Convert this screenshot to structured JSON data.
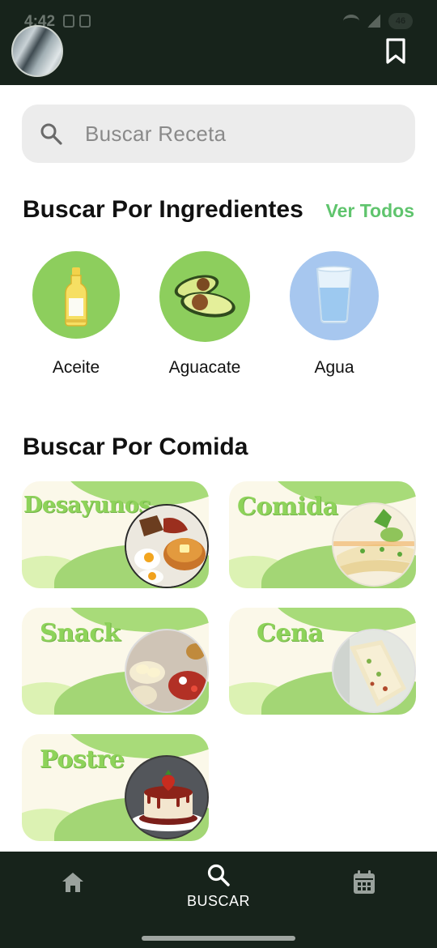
{
  "status_bar": {
    "time": "4:42",
    "battery": "46"
  },
  "search": {
    "placeholder": "Buscar Receta"
  },
  "ingredients_section": {
    "title": "Buscar Por Ingredientes",
    "see_all": "Ver Todos",
    "items": [
      {
        "label": "Aceite",
        "icon": "oil-bottle-icon",
        "bg": "#8dce5d"
      },
      {
        "label": "Aguacate",
        "icon": "avocado-icon",
        "bg": "#8dce5d"
      },
      {
        "label": "Agua",
        "icon": "water-glass-icon",
        "bg": "#a7c7ef"
      }
    ]
  },
  "meals_section": {
    "title": "Buscar Por Comida",
    "items": [
      {
        "label": "Desayunos",
        "icon": "breakfast-plate-icon"
      },
      {
        "label": "Comida",
        "icon": "enchiladas-plate-icon"
      },
      {
        "label": "Snack",
        "icon": "snack-plate-icon"
      },
      {
        "label": "Cena",
        "icon": "wrap-plate-icon"
      },
      {
        "label": "Postre",
        "icon": "flan-dessert-icon"
      }
    ]
  },
  "bottom_nav": {
    "items": [
      {
        "icon": "home-icon",
        "label": ""
      },
      {
        "icon": "search-icon",
        "label": "BUSCAR"
      },
      {
        "icon": "calendar-icon",
        "label": ""
      }
    ],
    "active": "BUSCAR"
  },
  "colors": {
    "dark": "#17231b",
    "accent": "#5fc46d",
    "card_green": "#a3d675"
  }
}
